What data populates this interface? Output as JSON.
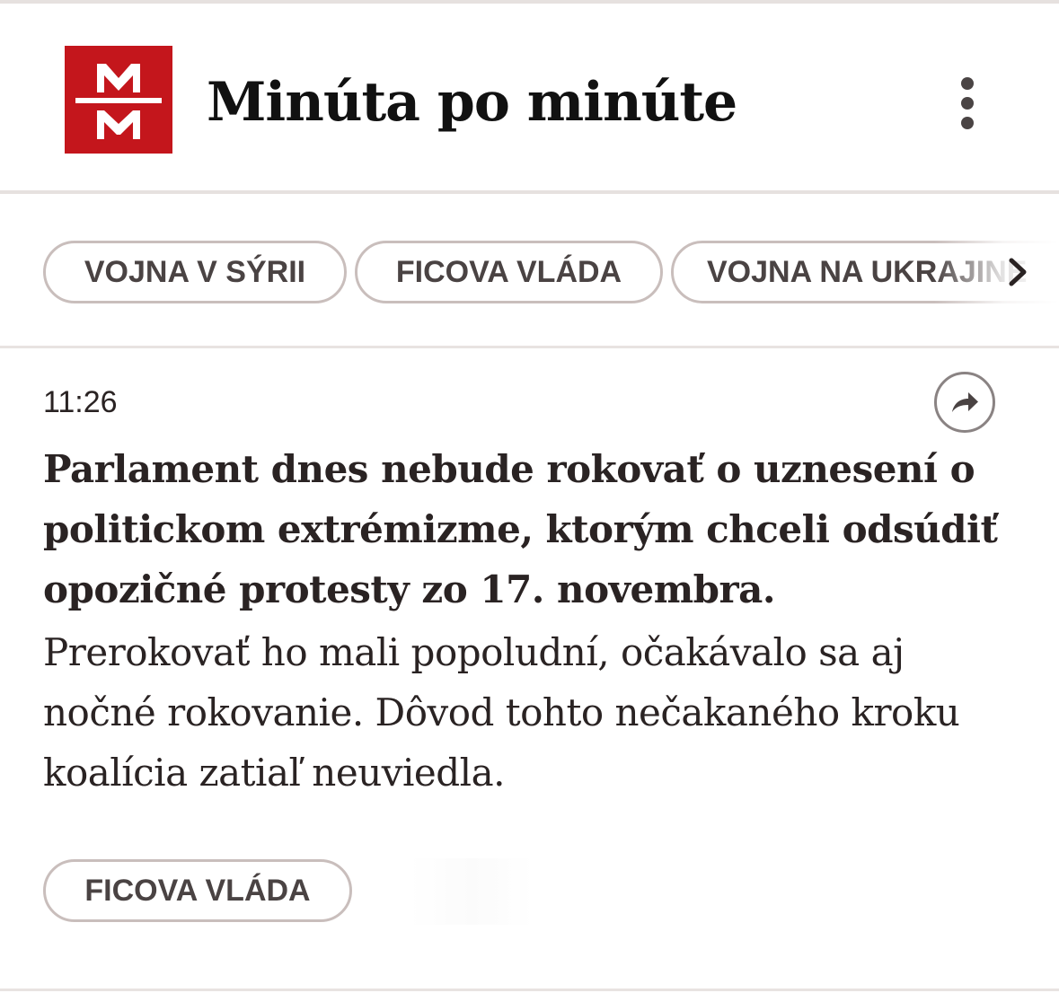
{
  "header": {
    "logo_letters": "M M",
    "title": "Minúta po minúte",
    "menu_icon": "more-vertical-icon"
  },
  "topics": [
    {
      "label": "VOJNA V SÝRII"
    },
    {
      "label": "FICOVA VLÁDA"
    },
    {
      "label": "VOJNA NA UKRAJINE"
    }
  ],
  "topics_scroll_icon": "chevron-right-icon",
  "entry": {
    "time": "11:26",
    "share_icon": "share-icon",
    "headline": "Parlament dnes nebude rokovať o uznesení o politickom extrémizme, ktorým chceli odsúdiť opozičné protesty zo 17. novembra.",
    "body": "Prerokovať ho mali popoludní, očakávalo sa aj nočné rokovanie. Dôvod tohto nečakaného kroku koalícia zatiaľ neuviedla.",
    "tag": "FICOVA VLÁDA"
  },
  "colors": {
    "brand_red": "#c4161c",
    "text": "#2a2323",
    "chip_border": "#c9bebc",
    "divider": "#e6e1df"
  }
}
